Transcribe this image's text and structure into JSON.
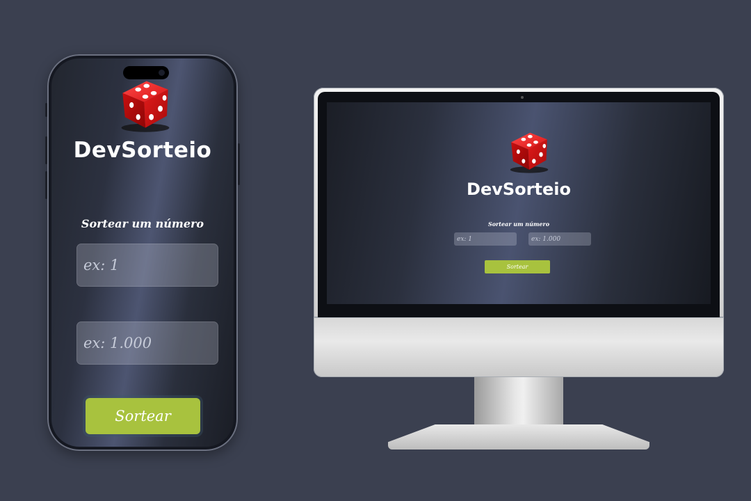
{
  "phone": {
    "app_title": "DevSorteio",
    "subtitle": "Sortear um número",
    "min_placeholder": "ex: 1",
    "max_placeholder": "ex: 1.000",
    "button_label": "Sortear",
    "logo_icon": "red-dice-icon"
  },
  "desktop": {
    "app_title": "DevSorteio",
    "subtitle": "Sortear um número",
    "min_placeholder": "ex: 1",
    "max_placeholder": "ex: 1.000",
    "button_label": "Sortear",
    "logo_icon": "red-dice-icon"
  },
  "colors": {
    "background": "#3b4050",
    "button": "#a8c23e",
    "dice": "#e01e1e"
  }
}
